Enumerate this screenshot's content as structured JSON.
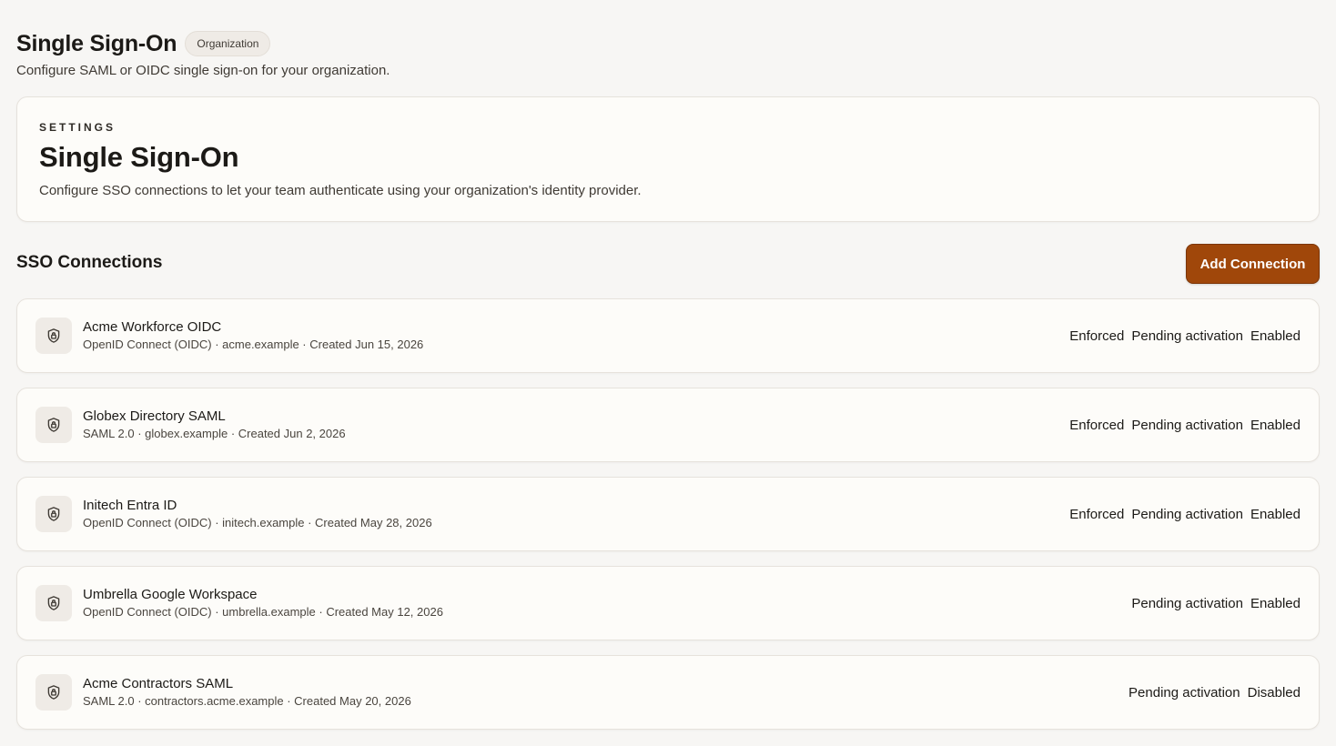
{
  "header": {
    "title": "Single Sign-On",
    "badge": "Organization",
    "subtitle": "Configure SAML or OIDC single sign-on for your organization."
  },
  "settings_card": {
    "eyebrow": "SETTINGS",
    "title": "Single Sign-On",
    "description": "Configure SSO connections to let your team authenticate using your organization's identity provider."
  },
  "connections_section": {
    "title": "SSO Connections",
    "add_button_label": "Add Connection"
  },
  "connections": [
    {
      "icon": "shield-lock-icon",
      "name": "Acme Workforce OIDC",
      "meta": "OpenID Connect (OIDC) · acme.example · Created Jun 15, 2026",
      "tags": [
        "Enforced",
        "Pending activation",
        "Enabled"
      ]
    },
    {
      "icon": "shield-lock-icon",
      "name": "Globex Directory SAML",
      "meta": "SAML 2.0 · globex.example · Created Jun 2, 2026",
      "tags": [
        "Enforced",
        "Pending activation",
        "Enabled"
      ]
    },
    {
      "icon": "shield-lock-icon",
      "name": "Initech Entra ID",
      "meta": "OpenID Connect (OIDC) · initech.example · Created May 28, 2026",
      "tags": [
        "Enforced",
        "Pending activation",
        "Enabled"
      ]
    },
    {
      "icon": "shield-lock-icon",
      "name": "Umbrella Google Workspace",
      "meta": "OpenID Connect (OIDC) · umbrella.example · Created May 12, 2026",
      "tags": [
        "Pending activation",
        "Enabled"
      ]
    },
    {
      "icon": "shield-lock-icon",
      "name": "Acme Contractors SAML",
      "meta": "SAML 2.0 · contractors.acme.example · Created May 20, 2026",
      "tags": [
        "Pending activation",
        "Disabled"
      ]
    }
  ],
  "colors": {
    "accent": "#a0470a",
    "background": "#f7f6f4",
    "card": "#fdfcf9"
  }
}
